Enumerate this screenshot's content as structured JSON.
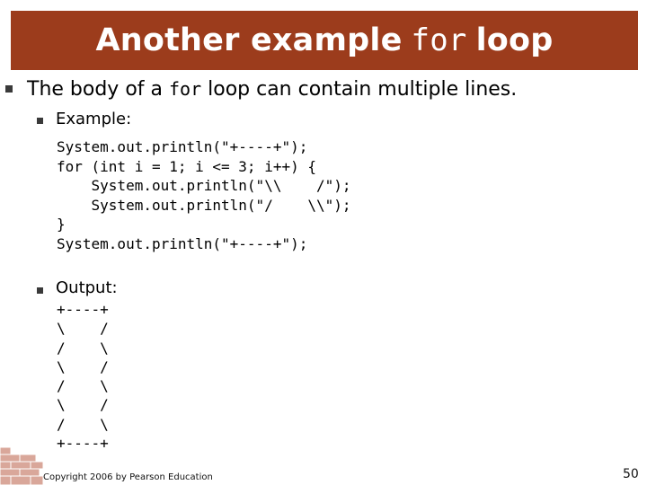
{
  "slide": {
    "title_prefix": "Another example",
    "title_code": "for",
    "title_suffix": "loop",
    "bullet1_before": "The body of a ",
    "bullet1_code": "for",
    "bullet1_after": " loop can contain multiple lines.",
    "example_label": "Example:",
    "code_lines": [
      "System.out.println(\"+----+\");",
      "for (int i = 1; i <= 3; i++) {",
      "    System.out.println(\"\\\\    /\");",
      "    System.out.println(\"/    \\\\\");",
      "}",
      "System.out.println(\"+----+\");"
    ],
    "output_label": "Output:",
    "output_lines": [
      "+----+",
      "\\    /",
      "/    \\",
      "\\    /",
      "/    \\",
      "\\    /",
      "/    \\",
      "+----+"
    ],
    "copyright": "Copyright 2006 by Pearson Education",
    "page_number": "50"
  },
  "colors": {
    "title_bar": "#9c3c1c",
    "title_text": "#ffffff",
    "bullet": "#3a3a3a",
    "brick": "#d9a79a"
  }
}
